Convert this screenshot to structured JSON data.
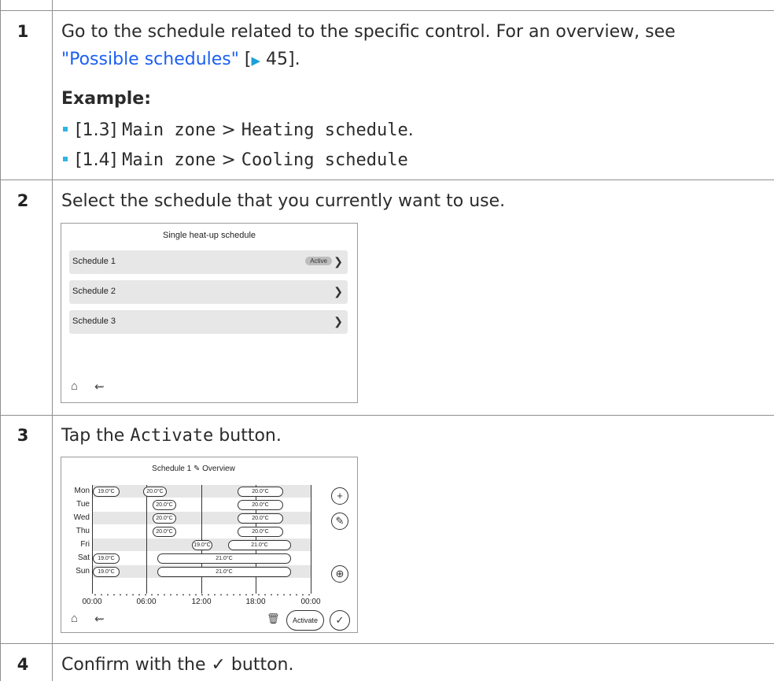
{
  "steps": [
    {
      "number": "1",
      "text": "Go to the schedule related to the specific control. For an overview, see",
      "link_text": "\"Possible schedules\"",
      "ref_open": " [",
      "ref_arrow": "▶",
      "ref_page": " 45",
      "ref_close": "].",
      "example_label": "Example:",
      "bullets": [
        {
          "ref": "[1.3]",
          "zone": "Main zone",
          "sep": " > ",
          "schedule": "Heating schedule",
          "end": "."
        },
        {
          "ref": "[1.4]",
          "zone": "Main zone",
          "sep": " > ",
          "schedule": "Cooling schedule",
          "end": ""
        }
      ]
    },
    {
      "number": "2",
      "text": "Select the schedule that you currently want to use."
    },
    {
      "number": "3",
      "text_before": "Tap the ",
      "code": "Activate",
      "text_after": " button."
    },
    {
      "number": "4",
      "text_before": "Confirm with the ",
      "check": "✓",
      "text_after": " button."
    }
  ],
  "screen1": {
    "title": "Single heat-up schedule",
    "rows": [
      {
        "label": "Schedule 1",
        "badge": "Active"
      },
      {
        "label": "Schedule 2"
      },
      {
        "label": "Schedule 3"
      }
    ],
    "home_icon": "home-icon",
    "back_icon": "back-icon"
  },
  "screen2": {
    "title_left": "Schedule 1",
    "title_right": "Overview",
    "days": [
      "Mon",
      "Tue",
      "Wed",
      "Thu",
      "Fri",
      "Sat",
      "Sun"
    ],
    "time_labels": [
      "00:00",
      "06:00",
      "12:00",
      "18:00",
      "00:00"
    ],
    "pills": {
      "mon": [
        "19.0°C",
        "20.0°C",
        "20.0°C"
      ],
      "tue": [
        "20.0°C",
        "20.0°C"
      ],
      "wed": [
        "20.0°C",
        "20.0°C"
      ],
      "thu": [
        "20.0°C",
        "20.0°C"
      ],
      "fri": [
        "19.0°C",
        "21.0°C"
      ],
      "sat": [
        "19.0°C",
        "21.0°C"
      ],
      "sun": [
        "19.0°C",
        "21.0°C"
      ]
    },
    "activate_label": "Activate"
  }
}
